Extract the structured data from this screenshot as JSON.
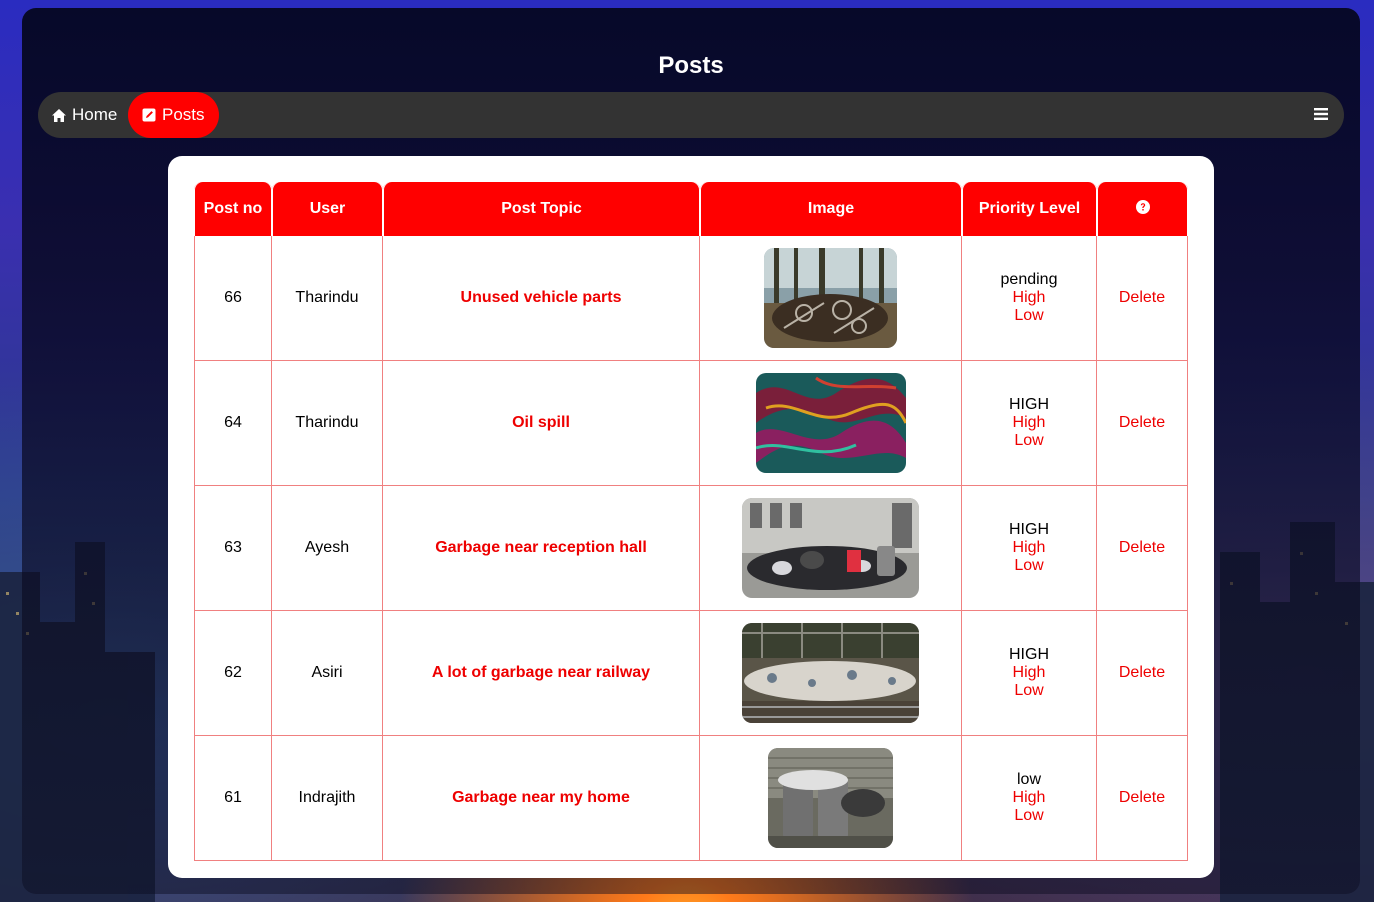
{
  "page": {
    "title": "Posts"
  },
  "nav": {
    "items": [
      {
        "label": "Home",
        "icon": "home-icon",
        "active": false
      },
      {
        "label": "Posts",
        "icon": "edit-icon",
        "active": true
      }
    ],
    "menu_icon": "hamburger-menu-icon"
  },
  "table": {
    "headers": [
      "Post no",
      "User",
      "Post Topic",
      "Image",
      "Priority Level"
    ],
    "action_header_icon": "question-circle-icon",
    "rows": [
      {
        "post_no": "66",
        "user": "Tharindu",
        "topic": "Unused vehicle parts",
        "image": "scrap-pile-photo",
        "priority": "pending",
        "opt_high": "High",
        "opt_low": "Low",
        "action": "Delete"
      },
      {
        "post_no": "64",
        "user": "Tharindu",
        "topic": "Oil spill",
        "image": "oil-spill-photo",
        "priority": "HIGH",
        "opt_high": "High",
        "opt_low": "Low",
        "action": "Delete"
      },
      {
        "post_no": "63",
        "user": "Ayesh",
        "topic": "Garbage near reception hall",
        "image": "garbage-bags-photo",
        "priority": "HIGH",
        "opt_high": "High",
        "opt_low": "Low",
        "action": "Delete"
      },
      {
        "post_no": "62",
        "user": "Asiri",
        "topic": "A lot of garbage near railway",
        "image": "railway-garbage-photo",
        "priority": "HIGH",
        "opt_high": "High",
        "opt_low": "Low",
        "action": "Delete"
      },
      {
        "post_no": "61",
        "user": "Indrajith",
        "topic": "Garbage near my home",
        "image": "garbage-bins-photo",
        "priority": "low",
        "opt_high": "High",
        "opt_low": "Low",
        "action": "Delete"
      }
    ]
  },
  "colors": {
    "accent": "#ff0000",
    "nav_bg": "#333333",
    "text_link": "#e00000"
  }
}
